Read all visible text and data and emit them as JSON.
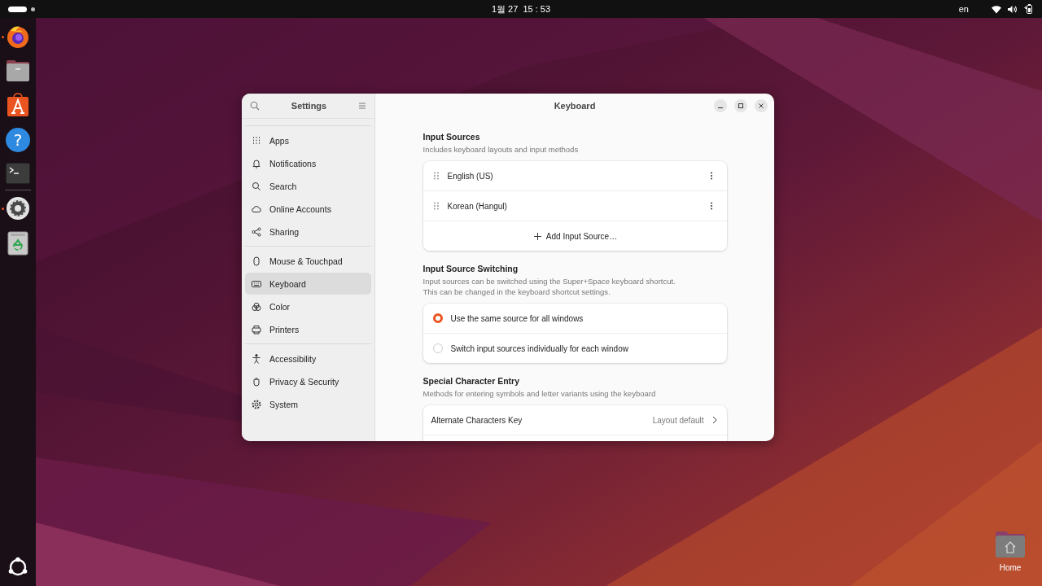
{
  "top_bar": {
    "clock": "1월 27  15 : 53",
    "input_indicator": "en"
  },
  "dock": {
    "apps": [
      {
        "running": true
      },
      {
        "running": false
      },
      {
        "running": false
      },
      {
        "running": false,
        "symbol": "?"
      },
      {
        "running": false
      },
      {
        "running": true
      },
      {
        "running": false
      }
    ]
  },
  "desktop": {
    "home_label": "Home"
  },
  "settings_window": {
    "sidebar": {
      "title": "Settings",
      "groups": [
        {
          "items": [
            {
              "label": "Apps",
              "selected": false
            },
            {
              "label": "Notifications",
              "selected": false
            },
            {
              "label": "Search",
              "selected": false
            },
            {
              "label": "Online Accounts",
              "selected": false
            },
            {
              "label": "Sharing",
              "selected": false
            }
          ]
        },
        {
          "items": [
            {
              "label": "Mouse & Touchpad",
              "selected": false
            },
            {
              "label": "Keyboard",
              "selected": true
            },
            {
              "label": "Color",
              "selected": false
            },
            {
              "label": "Printers",
              "selected": false
            }
          ]
        },
        {
          "items": [
            {
              "label": "Accessibility",
              "selected": false
            },
            {
              "label": "Privacy & Security",
              "selected": false
            },
            {
              "label": "System",
              "selected": false
            }
          ]
        }
      ]
    },
    "page": {
      "title": "Keyboard",
      "input_sources": {
        "title": "Input Sources",
        "subtitle": "Includes keyboard layouts and input methods",
        "sources": [
          {
            "name": "English (US)"
          },
          {
            "name": "Korean (Hangul)"
          }
        ],
        "add_button": "Add Input Source…"
      },
      "switching": {
        "title": "Input Source Switching",
        "description": "Input sources can be switched using the Super+Space keyboard shortcut.\nThis can be changed in the keyboard shortcut settings.",
        "options": [
          {
            "label": "Use the same source for all windows",
            "selected": true
          },
          {
            "label": "Switch input sources individually for each window",
            "selected": false
          }
        ]
      },
      "special_entry": {
        "title": "Special Character Entry",
        "subtitle": "Methods for entering symbols and letter variants using the keyboard",
        "rows": [
          {
            "label": "Alternate Characters Key",
            "value": "Layout default"
          }
        ]
      }
    }
  }
}
